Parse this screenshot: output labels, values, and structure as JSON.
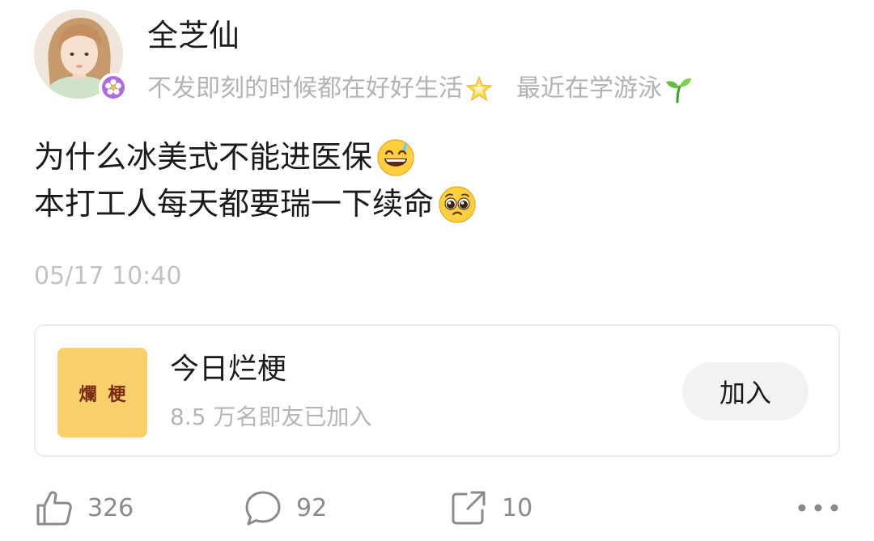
{
  "user": {
    "name": "全芝仙",
    "bio_part1": "不发即刻的时候都在好好生活",
    "bio_part1_emoji": "glowing-star-icon",
    "bio_part2": "最近在学游泳",
    "bio_part2_emoji": "seedling-icon",
    "badge_icon": "verified-flower-badge-icon"
  },
  "post": {
    "line1": "为什么冰美式不能进医保",
    "line1_emoji": "grinning-sweat-emoji",
    "line2": "本打工人每天都要瑞一下续命",
    "line2_emoji": "pleading-face-emoji",
    "timestamp": "05/17 10:40"
  },
  "group": {
    "thumb_text": "爛梗",
    "name": "今日烂梗",
    "members": "8.5 万名即友已加入",
    "join_label": "加入",
    "thumb_color": "#f8cf6a"
  },
  "actions": {
    "like_count": "326",
    "comment_count": "92",
    "share_count": "10"
  },
  "colors": {
    "text_primary": "#1a1a1a",
    "text_muted": "#b3b3b3",
    "icon": "#8a8a8a",
    "badge": "#b06be0"
  }
}
